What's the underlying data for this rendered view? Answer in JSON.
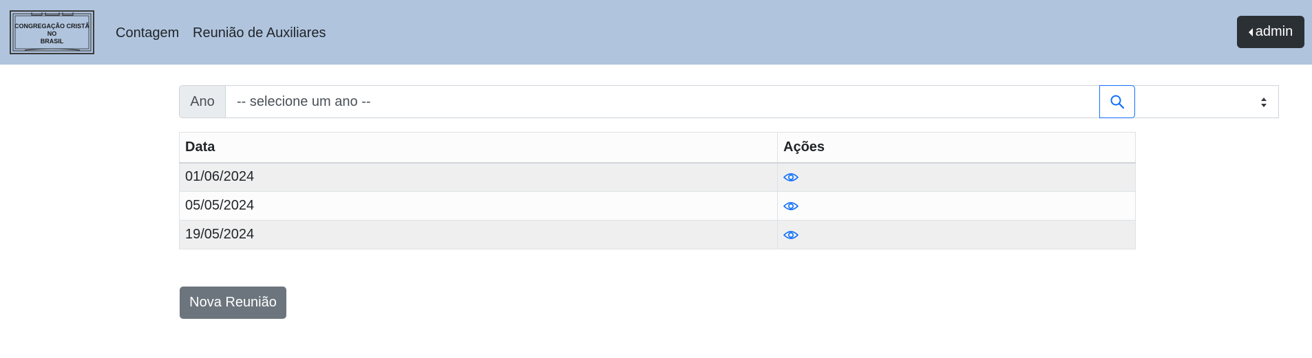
{
  "logo": {
    "lines": [
      "CONGREGAÇÃO CRISTÃ",
      "NO",
      "BRASIL"
    ]
  },
  "nav": {
    "links": [
      "Contagem",
      "Reunião de Auxiliares"
    ],
    "user_label": "admin"
  },
  "search": {
    "addon_label": "Ano",
    "select_value": "-- selecione um ano --"
  },
  "table": {
    "headers": [
      "Data",
      "Ações"
    ],
    "rows": [
      {
        "data": "01/06/2024"
      },
      {
        "data": "05/05/2024"
      },
      {
        "data": "19/05/2024"
      }
    ]
  },
  "actions": {
    "new_button": "Nova Reunião"
  },
  "colors": {
    "navbar": "#b0c4de",
    "primary": "#0d6efd",
    "dark": "#2b3035",
    "secondary": "#6c757d"
  }
}
